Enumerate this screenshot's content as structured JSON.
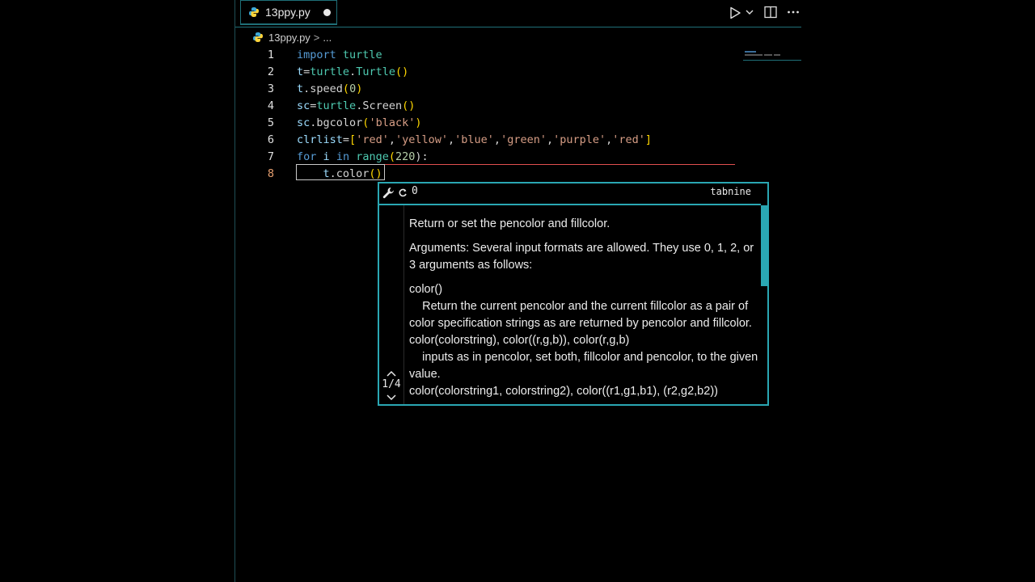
{
  "tab": {
    "filename": "13ppy.py",
    "dirty": true,
    "icon": "python-file-icon"
  },
  "breadcrumb": {
    "file": "13ppy.py",
    "separator": ">",
    "rest": "..."
  },
  "editor": {
    "line_numbers": [
      "1",
      "2",
      "3",
      "4",
      "5",
      "6",
      "7",
      "8"
    ],
    "lines": [
      [
        {
          "t": "import",
          "c": "kw"
        },
        {
          "t": " ",
          "c": "plain"
        },
        {
          "t": "turtle",
          "c": "fn"
        }
      ],
      [
        {
          "t": "t",
          "c": "var"
        },
        {
          "t": "=",
          "c": "plain"
        },
        {
          "t": "turtle",
          "c": "fn"
        },
        {
          "t": ".",
          "c": "plain"
        },
        {
          "t": "Turtle",
          "c": "fn"
        },
        {
          "t": "()",
          "c": "paren"
        }
      ],
      [
        {
          "t": "t",
          "c": "var"
        },
        {
          "t": ".speed",
          "c": "plain"
        },
        {
          "t": "(",
          "c": "paren"
        },
        {
          "t": "0",
          "c": "num"
        },
        {
          "t": ")",
          "c": "paren"
        }
      ],
      [
        {
          "t": "sc",
          "c": "var"
        },
        {
          "t": "=",
          "c": "plain"
        },
        {
          "t": "turtle",
          "c": "fn"
        },
        {
          "t": ".Screen",
          "c": "plain"
        },
        {
          "t": "()",
          "c": "paren"
        }
      ],
      [
        {
          "t": "sc",
          "c": "var"
        },
        {
          "t": ".bgcolor",
          "c": "plain"
        },
        {
          "t": "(",
          "c": "paren"
        },
        {
          "t": "'black'",
          "c": "str"
        },
        {
          "t": ")",
          "c": "paren"
        }
      ],
      [
        {
          "t": "clrlist",
          "c": "var"
        },
        {
          "t": "=",
          "c": "plain"
        },
        {
          "t": "[",
          "c": "paren"
        },
        {
          "t": "'red'",
          "c": "str"
        },
        {
          "t": ",",
          "c": "plain"
        },
        {
          "t": "'yellow'",
          "c": "str"
        },
        {
          "t": ",",
          "c": "plain"
        },
        {
          "t": "'blue'",
          "c": "str"
        },
        {
          "t": ",",
          "c": "plain"
        },
        {
          "t": "'green'",
          "c": "str"
        },
        {
          "t": ",",
          "c": "plain"
        },
        {
          "t": "'purple'",
          "c": "str"
        },
        {
          "t": ",",
          "c": "plain"
        },
        {
          "t": "'red'",
          "c": "str"
        },
        {
          "t": "]",
          "c": "paren"
        }
      ],
      [
        {
          "t": "for",
          "c": "kw"
        },
        {
          "t": " ",
          "c": "plain"
        },
        {
          "t": "i",
          "c": "var"
        },
        {
          "t": " ",
          "c": "plain"
        },
        {
          "t": "in",
          "c": "kw"
        },
        {
          "t": " ",
          "c": "plain"
        },
        {
          "t": "range",
          "c": "fn"
        },
        {
          "t": "(",
          "c": "paren"
        },
        {
          "t": "220",
          "c": "num"
        },
        {
          "t": "):",
          "c": "plain"
        }
      ],
      [
        {
          "t": "    t",
          "c": "var"
        },
        {
          "t": ".color",
          "c": "plain"
        },
        {
          "t": "()",
          "c": "paren"
        }
      ]
    ],
    "current_line": 8
  },
  "tooltip": {
    "header_count": "0",
    "source": "tabnine",
    "pager": {
      "up": "^",
      "count": "1/4",
      "down": "v"
    },
    "paragraphs": [
      "Return or set the pencolor and fillcolor.",
      "Arguments: Several input formats are allowed. They use 0, 1, 2, or 3 arguments as follows:"
    ],
    "lines": [
      "color()",
      "    Return the current pencolor and the current fillcolor as a pair of color specification strings as are returned by pencolor and fillcolor.",
      "color(colorstring), color((r,g,b)), color(r,g,b)",
      "    inputs as in pencolor, set both, fillcolor and pencolor, to the given value.",
      "color(colorstring1, colorstring2), color((r1,g1,b1), (r2,g2,b2))"
    ]
  },
  "colors": {
    "accent": "#2aa7b3",
    "error_underline": "#e05050",
    "background": "#000000"
  }
}
